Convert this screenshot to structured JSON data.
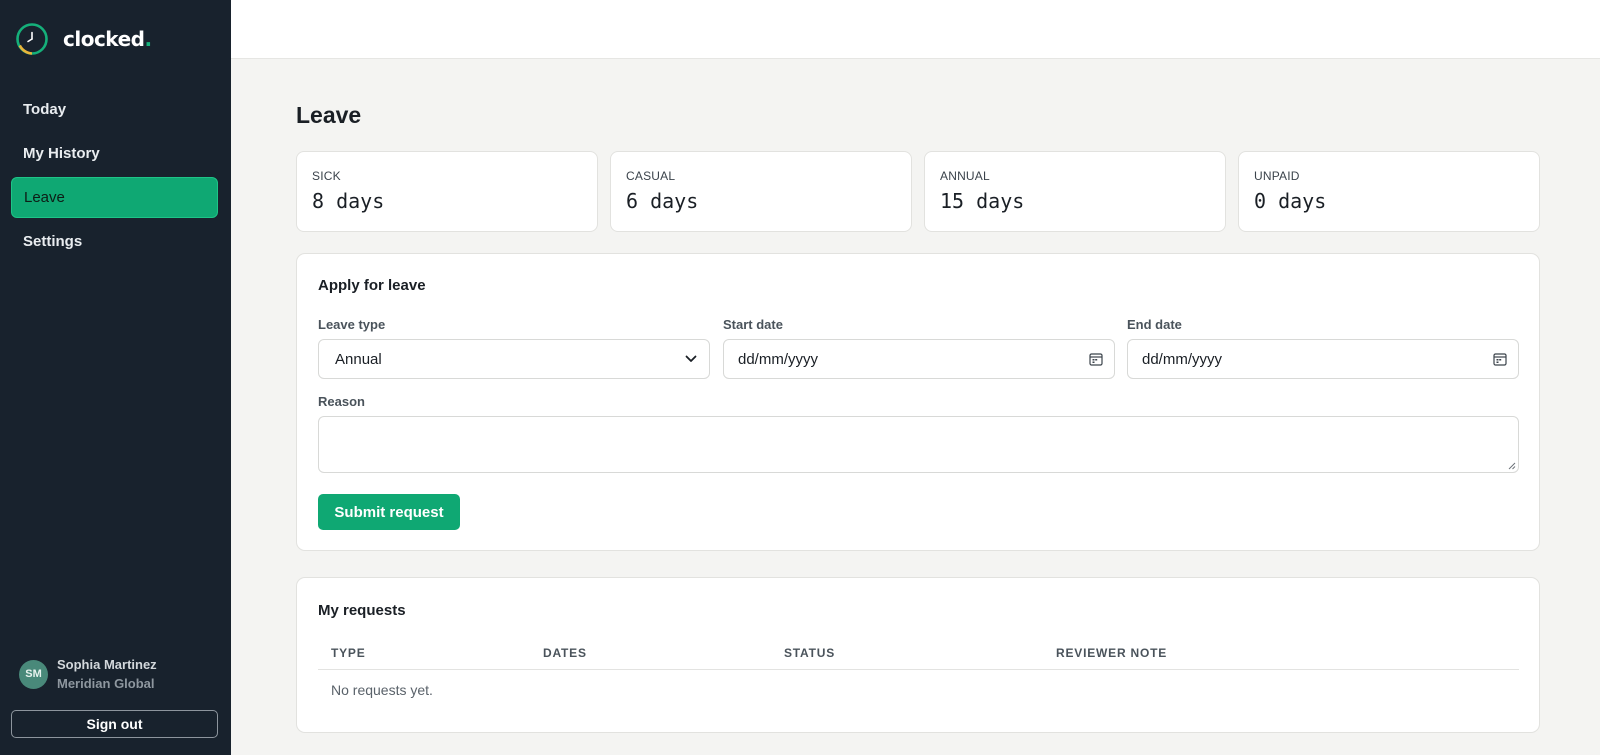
{
  "app": {
    "brand_name": "clocked",
    "brand_dot": ".",
    "accent_color": "#0fa873",
    "sidebar_color": "#18222d"
  },
  "sidebar": {
    "items": [
      {
        "label": "Today",
        "active": false
      },
      {
        "label": "My History",
        "active": false
      },
      {
        "label": "Leave",
        "active": true
      },
      {
        "label": "Settings",
        "active": false
      }
    ],
    "user": {
      "initials": "SM",
      "name": "Sophia Martinez",
      "org": "Meridian Global"
    },
    "signout_label": "Sign out"
  },
  "main": {
    "title": "Leave",
    "balances": [
      {
        "label": "SICK",
        "value": "8 days"
      },
      {
        "label": "CASUAL",
        "value": "6 days"
      },
      {
        "label": "ANNUAL",
        "value": "15 days"
      },
      {
        "label": "UNPAID",
        "value": "0 days"
      }
    ],
    "apply": {
      "title": "Apply for leave",
      "leave_type_label": "Leave type",
      "leave_type_value": "Annual",
      "start_label": "Start date",
      "start_placeholder": "dd/mm/yyyy",
      "end_label": "End date",
      "end_placeholder": "dd/mm/yyyy",
      "reason_label": "Reason",
      "reason_value": "",
      "submit_label": "Submit request"
    },
    "requests": {
      "title": "My requests",
      "columns": [
        "TYPE",
        "DATES",
        "STATUS",
        "REVIEWER NOTE"
      ],
      "empty_text": "No requests yet."
    }
  },
  "icons": {
    "logo": "clock-logo-icon",
    "select": "chevron-down-icon",
    "date": "calendar-icon"
  }
}
